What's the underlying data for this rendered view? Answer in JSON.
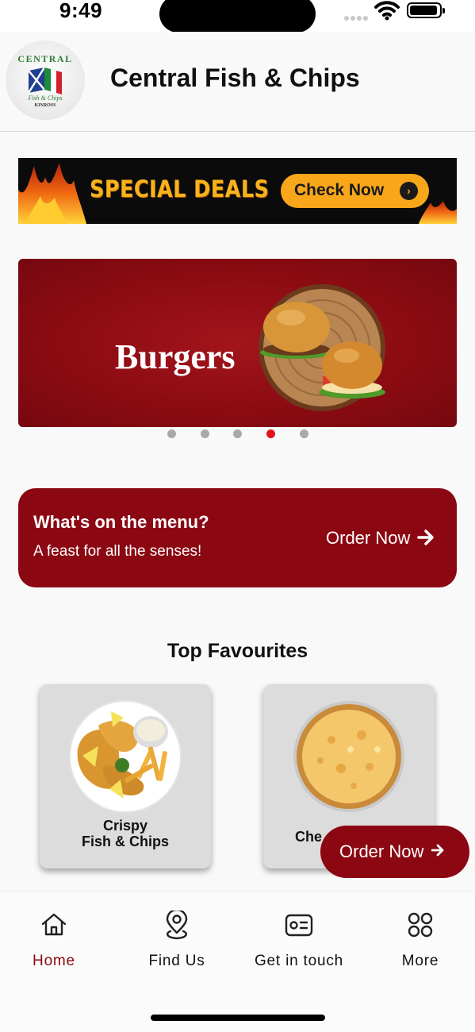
{
  "status_bar": {
    "time": "9:49"
  },
  "header": {
    "title": "Central Fish & Chips",
    "logo": {
      "top_text": "CENTRAL",
      "middle_text": "Fish & Chips",
      "bottom_text": "KINROSS"
    }
  },
  "deals_banner": {
    "text": "SPECIAL DEALS",
    "button_label": "Check Now"
  },
  "carousel": {
    "label": "Burgers",
    "slide_count": 5,
    "active_index": 3
  },
  "menu_card": {
    "title": "What's on the menu?",
    "subtitle": "A feast for all the senses!",
    "action_label": "Order Now"
  },
  "favourites": {
    "heading": "Top Favourites",
    "items": [
      {
        "line1": "Crispy",
        "line2": "Fish & Chips"
      },
      {
        "line1": "Che",
        "line2": ""
      }
    ]
  },
  "floating_button": {
    "label": "Order Now"
  },
  "bottom_nav": {
    "items": [
      {
        "label": "Home",
        "icon": "home-icon",
        "active": true
      },
      {
        "label": "Find Us",
        "icon": "location-pin-icon",
        "active": false
      },
      {
        "label": "Get in touch",
        "icon": "contact-card-icon",
        "active": false
      },
      {
        "label": "More",
        "icon": "grid-icon",
        "active": false
      }
    ]
  },
  "colors": {
    "brand": "#8b0712",
    "accent": "#f8a61a",
    "active_dot": "#e0141e"
  }
}
